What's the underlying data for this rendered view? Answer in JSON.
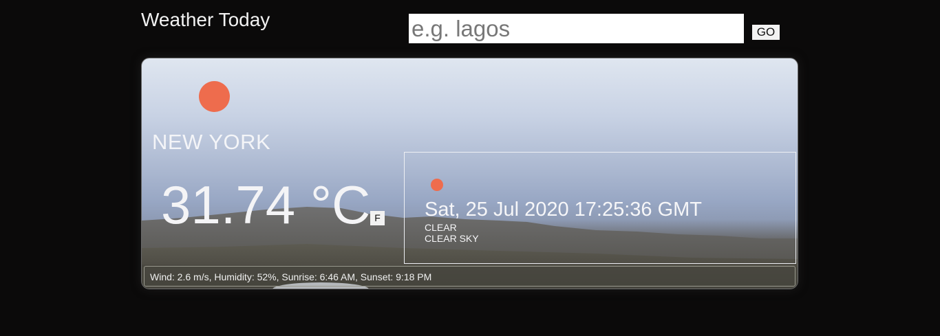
{
  "header": {
    "app_title": "Weather Today",
    "search_placeholder": "e.g. lagos",
    "search_value": "",
    "go_label": "GO"
  },
  "weather": {
    "city": "NEW YORK",
    "temperature": "31.74 °C",
    "unit_toggle_label": "F",
    "date_time": "Sat, 25 Jul 2020 17:25:36 GMT",
    "condition": "CLEAR",
    "condition_description": "CLEAR SKY",
    "stats": "Wind: 2.6 m/s, Humidity: 52%, Sunrise: 6:46 AM, Sunset: 9:18 PM",
    "icon": "sun-icon",
    "icon_color": "#ee6c4d"
  }
}
